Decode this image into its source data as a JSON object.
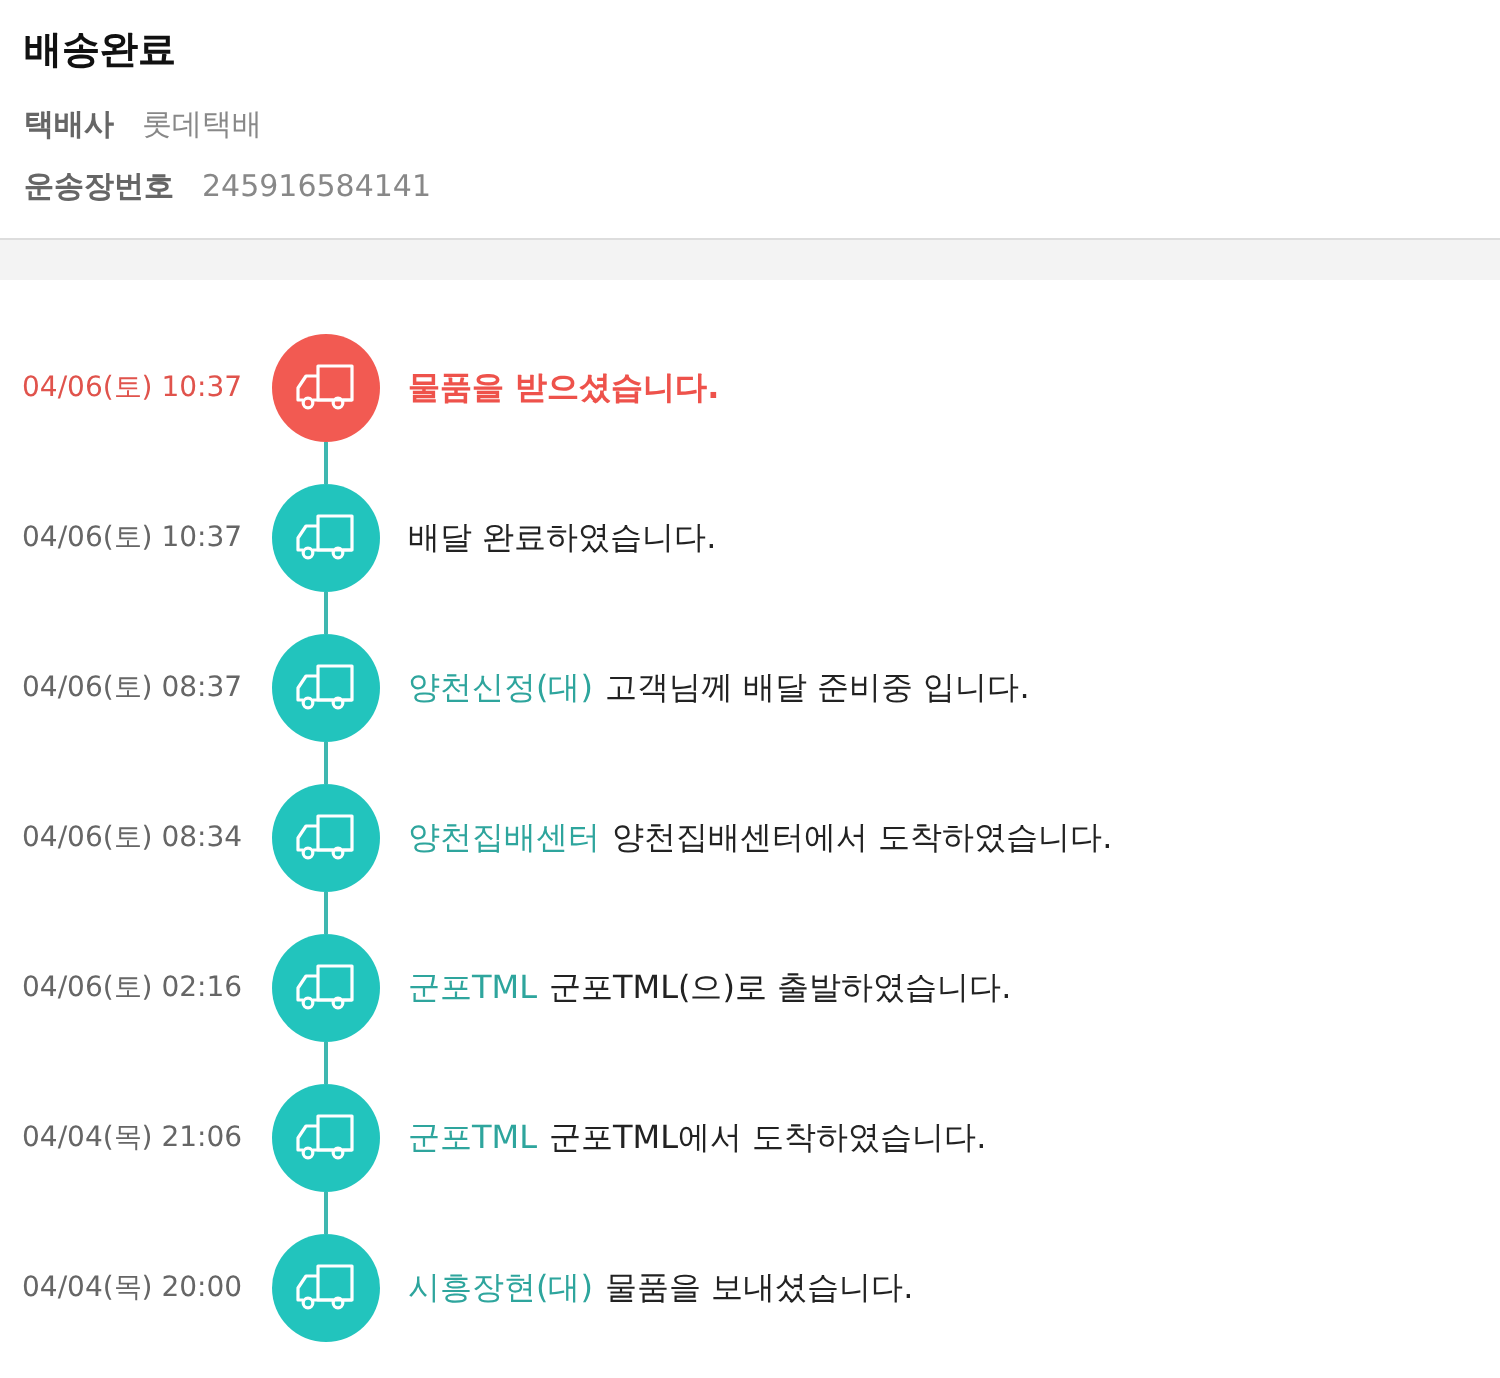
{
  "header": {
    "title": "배송완료",
    "fields": [
      {
        "label": "택배사",
        "value": "롯데택배"
      },
      {
        "label": "운송장번호",
        "value": "245916584141"
      }
    ]
  },
  "events": [
    {
      "time": "04/06(토) 10:37",
      "message": "물품을 받으셨습니다.",
      "current": true
    },
    {
      "time": "04/06(토) 10:37",
      "message": "배달 완료하였습니다.",
      "current": false
    },
    {
      "time": "04/06(토) 08:37",
      "location": "양천신정(대)",
      "message": "고객님께 배달 준비중 입니다.",
      "current": false
    },
    {
      "time": "04/06(토) 08:34",
      "location": "양천집배센터",
      "message": "양천집배센터에서 도착하였습니다.",
      "current": false
    },
    {
      "time": "04/06(토) 02:16",
      "location": "군포TML",
      "message": "군포TML(으)로 출발하였습니다.",
      "current": false
    },
    {
      "time": "04/04(목) 21:06",
      "location": "군포TML",
      "message": "군포TML에서 도착하였습니다.",
      "current": false
    },
    {
      "time": "04/04(목) 20:00",
      "location": "시흥장현(대)",
      "message": "물품을 보내셨습니다.",
      "current": false
    }
  ]
}
